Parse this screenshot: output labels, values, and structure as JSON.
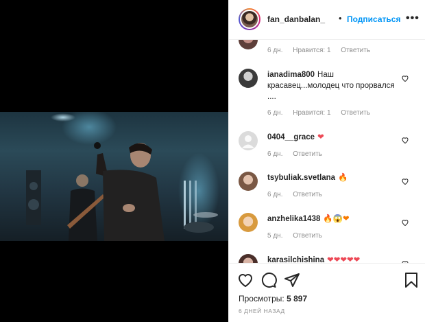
{
  "post": {
    "username": "fan_danbalan_",
    "dot": "•",
    "follow_label": "Подписаться",
    "more_label": "•••"
  },
  "comments": [
    {
      "username": "",
      "text": "",
      "time": "6 дн.",
      "likes": "Нравится: 1",
      "reply": "Ответить"
    },
    {
      "username": "ianadima800",
      "text": "Наш красавец...молодец что прорвался ....",
      "time": "6 дн.",
      "likes": "Нравится: 1",
      "reply": "Ответить"
    },
    {
      "username": "0404__grace",
      "text": "❤",
      "time": "6 дн.",
      "likes": "",
      "reply": "Ответить"
    },
    {
      "username": "tsybuliak.svetlana",
      "text": "🔥",
      "time": "6 дн.",
      "likes": "",
      "reply": "Ответить"
    },
    {
      "username": "anzhelika1438",
      "text": "🔥😱❤",
      "time": "5 дн.",
      "likes": "",
      "reply": "Ответить"
    },
    {
      "username": "karasilchishina",
      "text": "❤❤❤❤❤",
      "time": "",
      "likes": "",
      "reply": ""
    }
  ],
  "actions": {
    "icons": [
      "heart-icon",
      "comment-icon",
      "share-icon",
      "bookmark-icon"
    ],
    "views_label": "Просмотры:",
    "views_count": "5 897",
    "posted_ago": "6 ДНЕЙ НАЗАД"
  },
  "colors": {
    "link": "#0095f6",
    "meta": "#8e8e8e",
    "heart": "#ed4956",
    "text": "#262626"
  }
}
